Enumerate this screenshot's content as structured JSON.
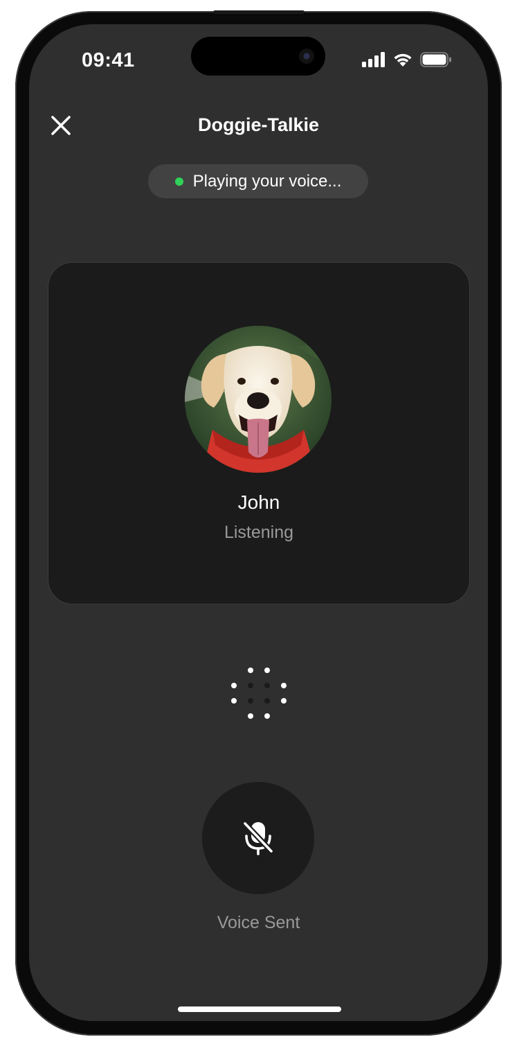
{
  "status_bar": {
    "time": "09:41",
    "signal_icon": "cellular-signal-icon",
    "wifi_icon": "wifi-icon",
    "battery_icon": "battery-icon"
  },
  "nav": {
    "close_icon": "close-icon",
    "title": "Doggie-Talkie"
  },
  "status_pill": {
    "text": "Playing your voice...",
    "dot_color": "#2fd158"
  },
  "card": {
    "name": "John",
    "status": "Listening"
  },
  "activity_indicator": {
    "icon": "loading-dots-icon"
  },
  "mic": {
    "icon": "microphone-off-icon",
    "label": "Voice Sent"
  },
  "colors": {
    "background": "#2f2f2f",
    "card": "#1b1b1b",
    "pill": "#424242",
    "accent_green": "#2fd158",
    "secondary_text": "#9a9a9a"
  }
}
